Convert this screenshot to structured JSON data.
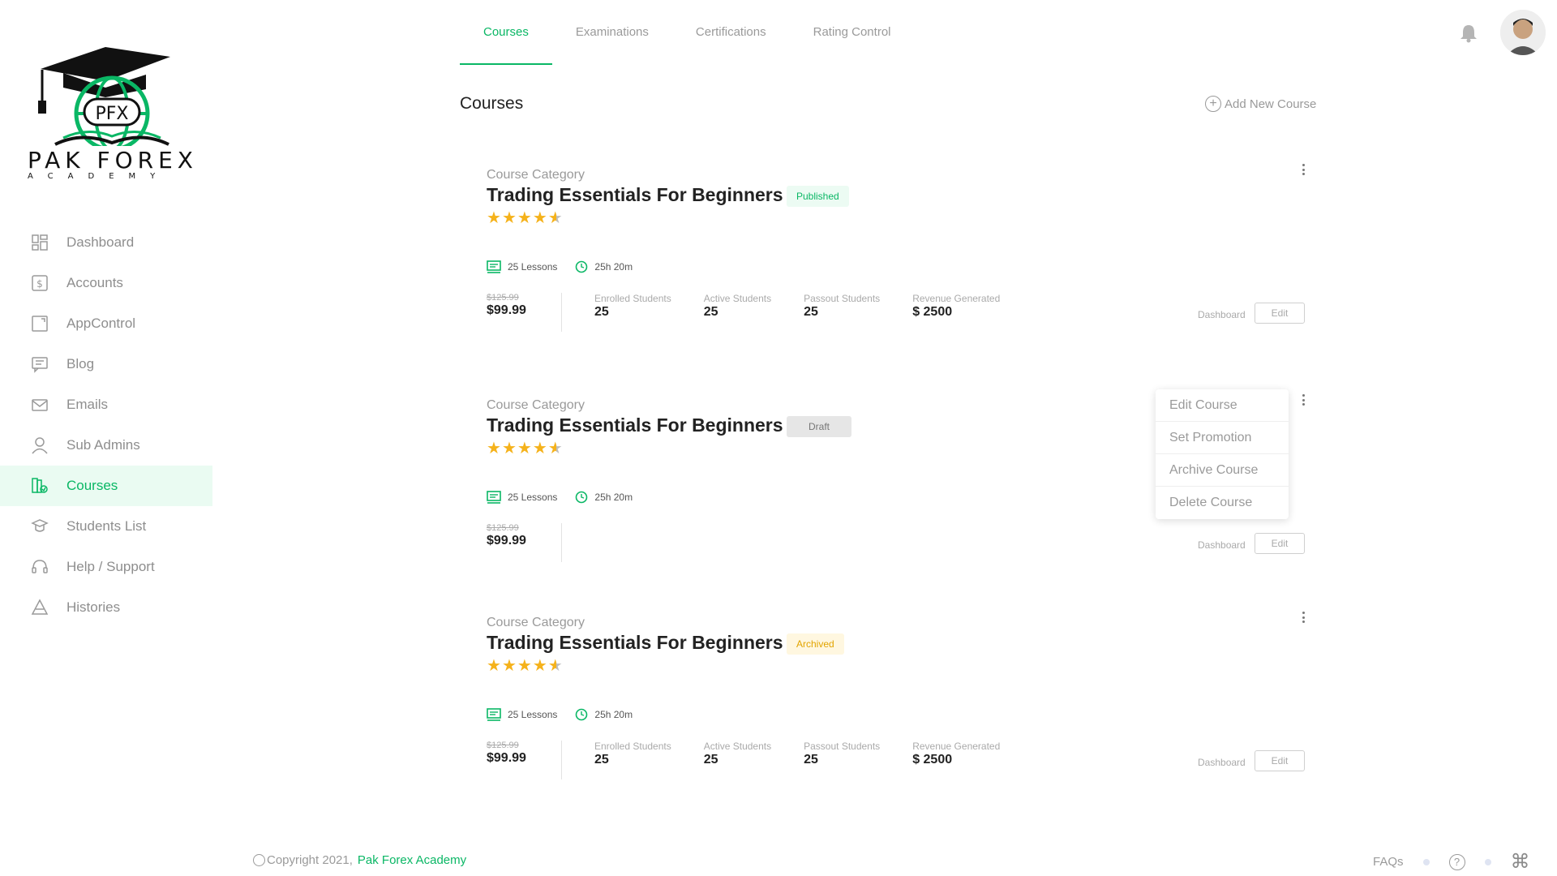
{
  "brand": {
    "logo_text": "PAK FOREX",
    "logo_sub": "ACADEMY",
    "logo_badge": "PFX",
    "accent_color": "#0ab765"
  },
  "sidebar": {
    "items": [
      {
        "label": "Dashboard",
        "icon": "dashboard-icon"
      },
      {
        "label": "Accounts",
        "icon": "dollar-icon"
      },
      {
        "label": "AppControl",
        "icon": "app-control-icon"
      },
      {
        "label": "Blog",
        "icon": "blog-icon"
      },
      {
        "label": "Emails",
        "icon": "email-icon"
      },
      {
        "label": "Sub Admins",
        "icon": "user-icon"
      },
      {
        "label": "Courses",
        "icon": "courses-icon",
        "active": true
      },
      {
        "label": "Students List",
        "icon": "student-icon"
      },
      {
        "label": "Help / Support",
        "icon": "support-icon"
      },
      {
        "label": "Histories",
        "icon": "history-icon"
      }
    ]
  },
  "tabs": [
    {
      "label": "Courses",
      "active": true
    },
    {
      "label": "Examinations"
    },
    {
      "label": "Certifications"
    },
    {
      "label": "Rating Control"
    }
  ],
  "header": {
    "bell_icon": "bell-icon",
    "avatar": "user-avatar"
  },
  "main": {
    "title": "Courses",
    "add_course_label": "Add New Course"
  },
  "courses": [
    {
      "category": "Course Category",
      "title": "Trading Essentials For Beginners",
      "status": "Published",
      "rating": 4.5,
      "lessons": "25 Lessons",
      "duration": "25h 20m",
      "old_price": "$125.99",
      "price": "$99.99",
      "stats": [
        {
          "label": "Enrolled Students",
          "value": "25"
        },
        {
          "label": "Active Students",
          "value": "25"
        },
        {
          "label": "Passout Students",
          "value": "25"
        },
        {
          "label": "Revenue Generated",
          "value": "$ 2500"
        }
      ],
      "dashboard_label": "Dashboard",
      "edit_label": "Edit"
    },
    {
      "category": "Course Category",
      "title": "Trading Essentials For Beginners",
      "status": "Draft",
      "rating": 4.5,
      "lessons": "25 Lessons",
      "duration": "25h 20m",
      "old_price": "$125.99",
      "price": "$99.99",
      "stats": [],
      "dashboard_label": "Dashboard",
      "edit_label": "Edit"
    },
    {
      "category": "Course Category",
      "title": "Trading Essentials For Beginners",
      "status": "Archived",
      "rating": 4.5,
      "lessons": "25 Lessons",
      "duration": "25h 20m",
      "old_price": "$125.99",
      "price": "$99.99",
      "stats": [
        {
          "label": "Enrolled Students",
          "value": "25"
        },
        {
          "label": "Active Students",
          "value": "25"
        },
        {
          "label": "Passout Students",
          "value": "25"
        },
        {
          "label": "Revenue Generated",
          "value": "$ 2500"
        }
      ],
      "dashboard_label": "Dashboard",
      "edit_label": "Edit"
    }
  ],
  "context_menu": {
    "items": [
      "Edit Course",
      "Set Promotion",
      "Archive Course",
      "Delete Course"
    ]
  },
  "footer": {
    "copyright": "Copyright 2021,",
    "brand": "Pak Forex Academy",
    "faqs": "FAQs",
    "help_icon": "question-icon",
    "command_icon": "command-icon"
  }
}
